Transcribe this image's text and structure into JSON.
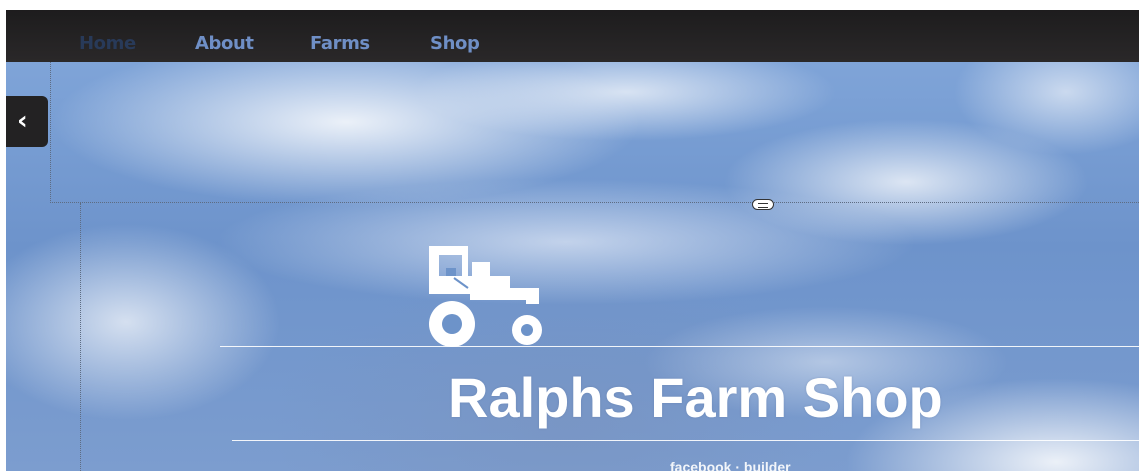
{
  "nav": {
    "items": [
      {
        "label": "Home"
      },
      {
        "label": "About"
      },
      {
        "label": "Farms"
      },
      {
        "label": "Shop"
      }
    ]
  },
  "hero": {
    "title": "Ralphs Farm Shop",
    "subtitle": "facebook · builder"
  },
  "icons": {
    "back": "chevron-left-icon",
    "resize": "resize-handle-icon",
    "logo": "tractor-icon"
  },
  "colors": {
    "nav_bar": "#1d1c1d",
    "nav_link": "#6f8fc6",
    "nav_active": "#283a59",
    "sky": "#6d93c9"
  }
}
